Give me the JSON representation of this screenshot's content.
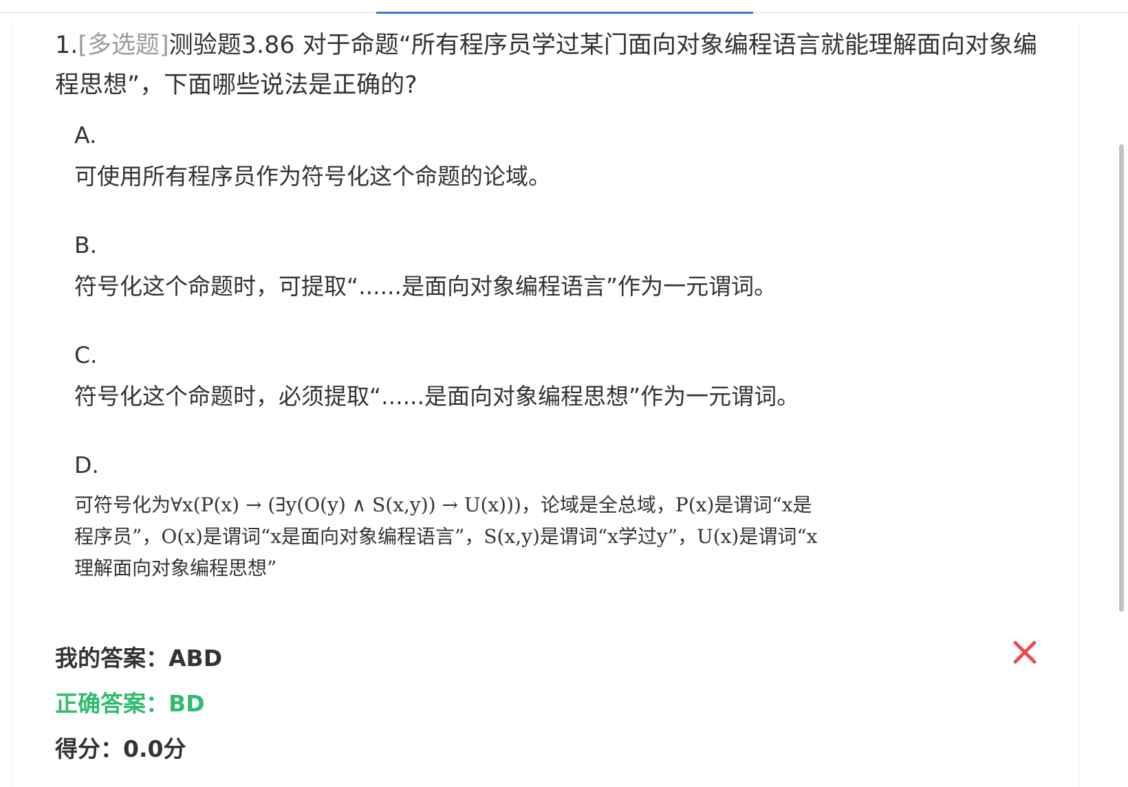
{
  "question": {
    "number": "1.",
    "type": "[多选题]",
    "text": "测验题3.86 对于命题“所有程序员学过某门面向对象编程语言就能理解面向对象编程思想”，下面哪些说法是正确的?"
  },
  "options": [
    {
      "letter": "A.",
      "text": "可使用所有程序员作为符号化这个命题的论域。"
    },
    {
      "letter": "B.",
      "text": "符号化这个命题时，可提取“......是面向对象编程语言”作为一元谓词。"
    },
    {
      "letter": "C.",
      "text": "符号化这个命题时，必须提取“......是面向对象编程思想”作为一元谓词。"
    },
    {
      "letter": "D.",
      "text": "可符号化为∀x(P(x) → (∃y(O(y) ∧ S(x,y)) → U(x)))，论域是全总域，P(x)是谓词“x是程序员”，O(x)是谓词“x是面向对象编程语言”，S(x,y)是谓词“x学过y”，U(x)是谓词“x理解面向对象编程思想”"
    }
  ],
  "result": {
    "my_answer": "我的答案：ABD",
    "correct_answer": "正确答案：BD",
    "score": "得分：0.0分",
    "wrong_icon": "close-icon",
    "wrong_color": "#f04a4a"
  },
  "colors": {
    "accent": "#2f7fd1",
    "correct": "#2ebc6c",
    "text": "#333333",
    "muted": "#9a9a9a"
  }
}
